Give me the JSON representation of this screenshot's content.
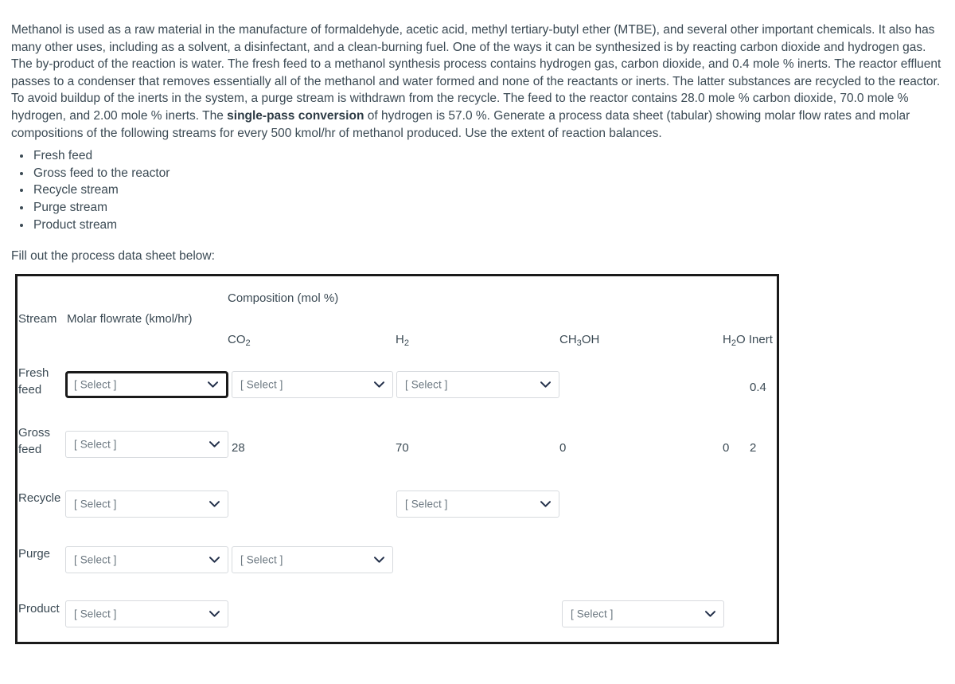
{
  "problem": {
    "paragraph_html": "Methanol is used as a raw material in the manufacture of formaldehyde, acetic acid, methyl tertiary-butyl ether (MTBE), and several other important chemicals. It also has many other uses, including as a solvent, a disinfectant, and a clean-burning fuel. One of the ways it can be synthesized is by reacting carbon dioxide and hydrogen gas. The by-product of the reaction is water. The fresh feed to a methanol synthesis process contains hydrogen gas, carbon dioxide, and 0.4 mole % inerts. The reactor effluent passes to a condenser that removes essentially all of the methanol and water formed and none of the reactants or inerts. The latter substances are recycled to the reactor. To avoid buildup of the inerts in the system, a purge stream is withdrawn from the recycle. The feed to the reactor contains 28.0 mole % carbon dioxide, 70.0 mole % hydrogen, and 2.00 mole % inerts. The <b>single-pass conversion</b> of hydrogen is 57.0 %. Generate a process data sheet (tabular) showing molar flow rates and molar compositions of the following streams for every 500 kmol/hr of methanol produced. Use the extent of reaction balances.",
    "streams": [
      "Fresh feed",
      "Gross feed to the reactor",
      "Recycle stream",
      "Purge stream",
      "Product stream"
    ],
    "instruction": "Fill out the process data sheet below:"
  },
  "table": {
    "headers": {
      "composition": "Composition (mol %)",
      "stream": "Stream",
      "flowrate": "Molar flowrate (kmol/hr)",
      "co2": "CO2",
      "h2": "H2",
      "ch3oh": "CH3OH",
      "h2o_inert": "H2O Inert"
    },
    "select_placeholder": "[ Select ]",
    "rows": [
      {
        "label": "Fresh feed",
        "label_line1": "Fresh",
        "label_line2": "feed",
        "flowrate": {
          "type": "select",
          "value": "[ Select ]",
          "focused": true
        },
        "co2": {
          "type": "select",
          "value": "[ Select ]",
          "focused": false
        },
        "h2": {
          "type": "select",
          "value": "[ Select ]",
          "focused": false
        },
        "ch3oh": {
          "type": "empty",
          "value": ""
        },
        "h2o": {
          "type": "empty",
          "value": ""
        },
        "inert": {
          "type": "text",
          "value": "0.4"
        }
      },
      {
        "label": "Gross feed",
        "label_line1": "Gross",
        "label_line2": "feed",
        "flowrate": {
          "type": "select",
          "value": "[ Select ]",
          "focused": false
        },
        "co2": {
          "type": "text",
          "value": "28"
        },
        "h2": {
          "type": "text",
          "value": "70"
        },
        "ch3oh": {
          "type": "text",
          "value": "0"
        },
        "h2o": {
          "type": "text",
          "value": "0"
        },
        "inert": {
          "type": "text",
          "value": "2"
        }
      },
      {
        "label": "Recycle",
        "label_line1": "Recycle",
        "label_line2": "",
        "flowrate": {
          "type": "select",
          "value": "[ Select ]",
          "focused": false
        },
        "co2": {
          "type": "empty",
          "value": ""
        },
        "h2": {
          "type": "select",
          "value": "[ Select ]",
          "focused": false
        },
        "ch3oh": {
          "type": "empty",
          "value": ""
        },
        "h2o": {
          "type": "empty",
          "value": ""
        },
        "inert": {
          "type": "empty",
          "value": ""
        }
      },
      {
        "label": "Purge",
        "label_line1": "Purge",
        "label_line2": "",
        "flowrate": {
          "type": "select",
          "value": "[ Select ]",
          "focused": false
        },
        "co2": {
          "type": "select",
          "value": "[ Select ]",
          "focused": false
        },
        "h2": {
          "type": "empty",
          "value": ""
        },
        "ch3oh": {
          "type": "empty",
          "value": ""
        },
        "h2o": {
          "type": "empty",
          "value": ""
        },
        "inert": {
          "type": "empty",
          "value": ""
        }
      },
      {
        "label": "Product",
        "label_line1": "Product",
        "label_line2": "",
        "flowrate": {
          "type": "select",
          "value": "[ Select ]",
          "focused": false
        },
        "co2": {
          "type": "empty",
          "value": ""
        },
        "h2": {
          "type": "empty",
          "value": ""
        },
        "ch3oh": {
          "type": "select",
          "value": "[ Select ]",
          "focused": false
        },
        "h2o": {
          "type": "empty",
          "value": ""
        },
        "inert": {
          "type": "empty",
          "value": ""
        }
      }
    ]
  },
  "colors": {
    "text": "#3b4a54",
    "border": "#1a1a1a",
    "select_border": "#d7dade",
    "placeholder": "#6b7780"
  },
  "icons": {
    "chevron": "chevron-down-icon"
  }
}
